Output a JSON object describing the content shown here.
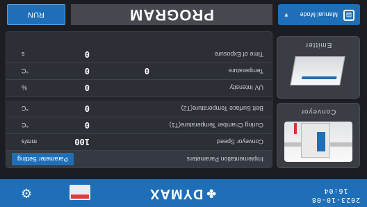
{
  "footer": {
    "date": "2023-10-08",
    "time": "16:04",
    "brand": "DYMAX",
    "brand_mark": "✤",
    "settings_icon": "gear-icon",
    "dashboard_icon": "window-icon"
  },
  "header": {
    "mode": "Manual Mode",
    "mode_icon": "mode-icon",
    "title": "PROGRAM",
    "run_label": "RUN"
  },
  "side": {
    "conveyor_label": "Conveyor",
    "emitter_label": "Emitter"
  },
  "table": {
    "section_label": "Implementation Parameters",
    "parameter_setting_label": "Parameter Setting",
    "rows": [
      {
        "name": "Conveyor Speed",
        "value": "100",
        "value2": "",
        "unit": "mm/s"
      },
      {
        "name": "Curing Chamber Temperature(T1)",
        "value": "0",
        "value2": "",
        "unit": "°C"
      },
      {
        "name": "Belt Surface Temperature(T2)",
        "value": "0",
        "value2": "",
        "unit": "°C"
      },
      {
        "name": "UV Intensity",
        "value": "0",
        "value2": "",
        "unit": "%"
      },
      {
        "name": "Temperature",
        "value": "0",
        "value2": "0",
        "unit": "°C"
      },
      {
        "name": "Time of Exposure",
        "value": "0",
        "value2": "",
        "unit": "s"
      }
    ]
  },
  "colors": {
    "accent": "#1f6fb8",
    "background": "#1b1d22",
    "panel": "#2c2f35",
    "alert": "#e23b3b"
  }
}
